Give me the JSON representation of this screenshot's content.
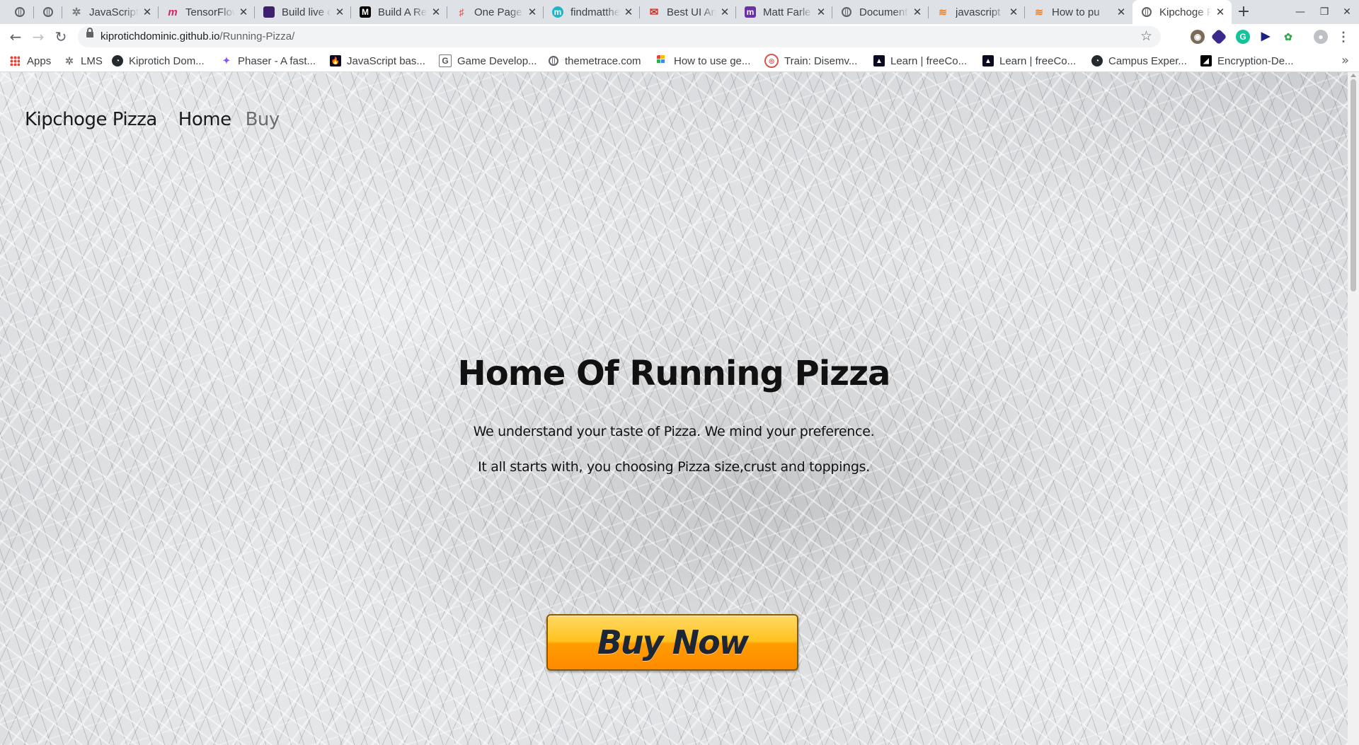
{
  "tabs": [
    {
      "title": "",
      "icon": "globe-icon"
    },
    {
      "title": "",
      "icon": "globe-icon"
    },
    {
      "title": "JavaScript",
      "icon": "javascript-tab-icon"
    },
    {
      "title": "TensorFlow",
      "icon": "tensorflow-icon"
    },
    {
      "title": "Build live c",
      "icon": "build-live-icon"
    },
    {
      "title": "Build A Re",
      "icon": "medium-icon"
    },
    {
      "title": "One Page",
      "icon": "onepage-icon"
    },
    {
      "title": "findmatthe",
      "icon": "findmatthew-icon"
    },
    {
      "title": "Best UI An",
      "icon": "gmail-icon"
    },
    {
      "title": "Matt Farle",
      "icon": "matt-farley-icon"
    },
    {
      "title": "Document",
      "icon": "globe-icon"
    },
    {
      "title": "javascript",
      "icon": "stackoverflow-icon"
    },
    {
      "title": "How to pu",
      "icon": "stackoverflow-icon"
    },
    {
      "title": "Kipchoge F",
      "icon": "globe-icon",
      "active": true
    }
  ],
  "browser": {
    "url_host": "kiprotichdominic.github.io",
    "url_path": "/Running-Pizza/"
  },
  "bookmarks": [
    {
      "label": "Apps",
      "icon": "apps-grid-icon"
    },
    {
      "label": "LMS",
      "icon": "lms-icon"
    },
    {
      "label": "Kiprotich Dom...",
      "icon": "github-icon"
    },
    {
      "label": "Phaser - A fast...",
      "icon": "phaser-icon"
    },
    {
      "label": "JavaScript bas...",
      "icon": "freecodecamp-icon"
    },
    {
      "label": "Game Develop...",
      "icon": "game-dev-icon"
    },
    {
      "label": "themetrace.com",
      "icon": "globe-icon"
    },
    {
      "label": "How to use ge...",
      "icon": "grid-icon"
    },
    {
      "label": "Train: Disemv...",
      "icon": "codewars-icon"
    },
    {
      "label": "Learn | freeCo...",
      "icon": "freecodecamp-icon"
    },
    {
      "label": "Learn | freeCo...",
      "icon": "freecodecamp-icon"
    },
    {
      "label": "Campus Exper...",
      "icon": "github-icon"
    },
    {
      "label": "Encryption-De...",
      "icon": "encryption-icon"
    }
  ],
  "site": {
    "brand": "Kipchoge Pizza",
    "nav_home": "Home",
    "nav_buy": "Buy",
    "hero_title": "Home Of Running Pizza",
    "hero_line1": "We understand your taste of Pizza. We mind your preference.",
    "hero_line2": "It all starts with, you choosing Pizza size,crust and toppings.",
    "buy_button": "Buy Now"
  },
  "colors": {
    "active_tab": "#ffffff",
    "tabstrip": "#dee1e6",
    "buy_button_top": "#ffd964",
    "buy_button_bottom": "#ff8a00"
  }
}
